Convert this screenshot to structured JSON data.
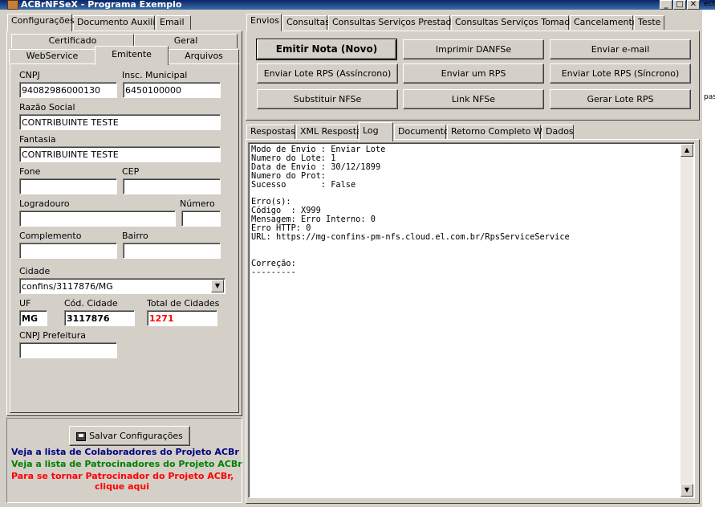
{
  "window": {
    "title": "ACBrNFSeX - Programa Exemplo",
    "right_edge_texts": [
      "ect",
      "pas"
    ]
  },
  "left": {
    "top_tabs": [
      "Configurações",
      "Documento Auxiliar",
      "Email"
    ],
    "config_tabs_row1": [
      "Certificado",
      "Geral"
    ],
    "config_tabs_row2": [
      "WebService",
      "Emitente",
      "Arquivos"
    ],
    "emitente": {
      "cnpj_label": "CNPJ",
      "cnpj_value": "94082986000130",
      "im_label": "Insc. Municipal",
      "im_value": "6450100000",
      "razao_label": "Razão Social",
      "razao_value": "CONTRIBUINTE TESTE",
      "fantasia_label": "Fantasia",
      "fantasia_value": "CONTRIBUINTE TESTE",
      "fone_label": "Fone",
      "fone_value": "",
      "cep_label": "CEP",
      "cep_value": "",
      "logradouro_label": "Logradouro",
      "logradouro_value": "",
      "numero_label": "Número",
      "numero_value": "",
      "complemento_label": "Complemento",
      "complemento_value": "",
      "bairro_label": "Bairro",
      "bairro_value": "",
      "cidade_label": "Cidade",
      "cidade_value": "confins/3117876/MG",
      "uf_label": "UF",
      "uf_value": "MG",
      "cod_cidade_label": "Cód. Cidade",
      "cod_cidade_value": "3117876",
      "total_cidades_label": "Total de Cidades",
      "total_cidades_value": "1271",
      "cnpj_prefeitura_label": "CNPJ Prefeitura",
      "cnpj_prefeitura_value": ""
    },
    "save_button": "Salvar Configurações",
    "link_colaboradores": "Veja a lista de Colaboradores do Projeto ACBr",
    "link_patrocinadores": "Veja a lista de Patrocinadores do Projeto ACBr",
    "link_patrocinar_1": "Para se tornar Patrocinador do Projeto ACBr,",
    "link_patrocinar_2": "clique aqui",
    "colors": {
      "link_blue": "#000080",
      "link_green": "#008000",
      "link_red": "#ff0000",
      "total_red": "#ff0000"
    }
  },
  "right": {
    "top_tabs": [
      "Envios",
      "Consultas",
      "Consultas Serviços Prestados",
      "Consultas Serviços Tomados",
      "Cancelamento",
      "Teste"
    ],
    "buttons": [
      "Emitir Nota (Novo)",
      "Imprimir DANFSe",
      "Enviar e-mail",
      "Enviar Lote RPS (Assíncrono)",
      "Enviar um RPS",
      "Enviar Lote RPS (Síncrono)",
      "Substituir NFSe",
      "Link NFSe",
      "Gerar Lote RPS"
    ],
    "result_tabs": [
      "Respostas",
      "XML Resposta",
      "Log",
      "Documento",
      "Retorno Completo WS",
      "Dados"
    ],
    "log_text": "Modo de Envio : Enviar Lote\nNumero do Lote: 1\nData de Envio : 30/12/1899\nNumero do Prot:\nSucesso       : False\n\nErro(s):\nCódigo  : X999\nMensagem: Erro Interno: 0\nErro HTTP: 0\nURL: https://mg-confins-pm-nfs.cloud.el.com.br/RpsServiceService\n\n\nCorreção:\n---------"
  }
}
